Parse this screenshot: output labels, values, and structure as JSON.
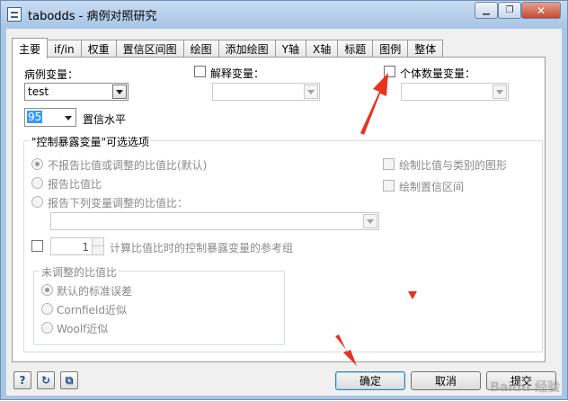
{
  "window": {
    "title": "tabodds - 病例对照研究",
    "minimize_glyph": "▁",
    "restore_glyph": "❐",
    "close_glyph": "✕"
  },
  "tabs": [
    {
      "label": "主要",
      "active": true
    },
    {
      "label": "if/in"
    },
    {
      "label": "权重"
    },
    {
      "label": "置信区间图"
    },
    {
      "label": "绘图"
    },
    {
      "label": "添加绘图"
    },
    {
      "label": "Y轴"
    },
    {
      "label": "X轴"
    },
    {
      "label": "标题"
    },
    {
      "label": "图例"
    },
    {
      "label": "整体"
    }
  ],
  "main": {
    "case_var_label": "病例变量：",
    "case_var_value": "test",
    "explanatory_label": "解释变量：",
    "count_var_label": "个体数量变量：",
    "level_value": "95",
    "level_label": "置信水平"
  },
  "exposure_group": {
    "title": "\"控制暴露变量\"可选选项",
    "radio_default": "不报告比值或调整的比值比(默认)",
    "radio_or": "报告比值比",
    "radio_adjusted": "报告下列变量调整的比值比：",
    "graph_ratio": "绘制比值与类别的图形",
    "graph_ci": "绘制置信区间",
    "ref_value": "1",
    "ref_label": "计算比值比时的控制暴露变量的参考组"
  },
  "unadjusted_group": {
    "title": "未调整的比值比",
    "radio_default_se": "默认的标准误差",
    "radio_cornfield": "Cornfield近似",
    "radio_woolf": "Woolf近似"
  },
  "footer": {
    "help_glyph": "?",
    "reset_glyph": "↻",
    "copy_glyph": "⧉",
    "ok_label": "确定",
    "cancel_label": "取消",
    "submit_label": "提交"
  },
  "annotations": {
    "arrow_color": "#e8321c"
  },
  "watermark": "Baidu 经验"
}
